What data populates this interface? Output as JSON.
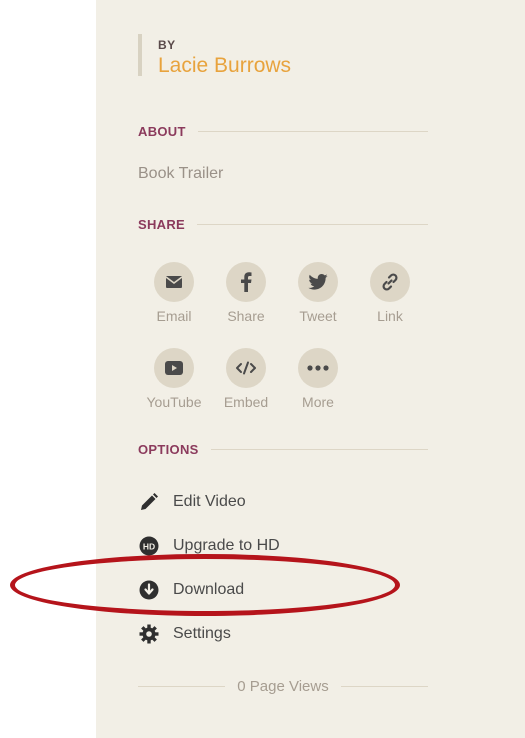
{
  "author": {
    "by_label": "BY",
    "name": "Lacie Burrows"
  },
  "about": {
    "heading": "ABOUT",
    "text": "Book Trailer"
  },
  "share": {
    "heading": "SHARE",
    "items": [
      {
        "label": "Email"
      },
      {
        "label": "Share"
      },
      {
        "label": "Tweet"
      },
      {
        "label": "Link"
      },
      {
        "label": "YouTube"
      },
      {
        "label": "Embed"
      },
      {
        "label": "More"
      }
    ]
  },
  "options": {
    "heading": "OPTIONS",
    "items": [
      {
        "label": "Edit Video"
      },
      {
        "label": "Upgrade to HD"
      },
      {
        "label": "Download"
      },
      {
        "label": "Settings"
      }
    ]
  },
  "footer": {
    "page_views": "0 Page Views"
  },
  "colors": {
    "accent": "#e8a33d",
    "section": "#8b3a5c",
    "annotation": "#b5141b"
  }
}
